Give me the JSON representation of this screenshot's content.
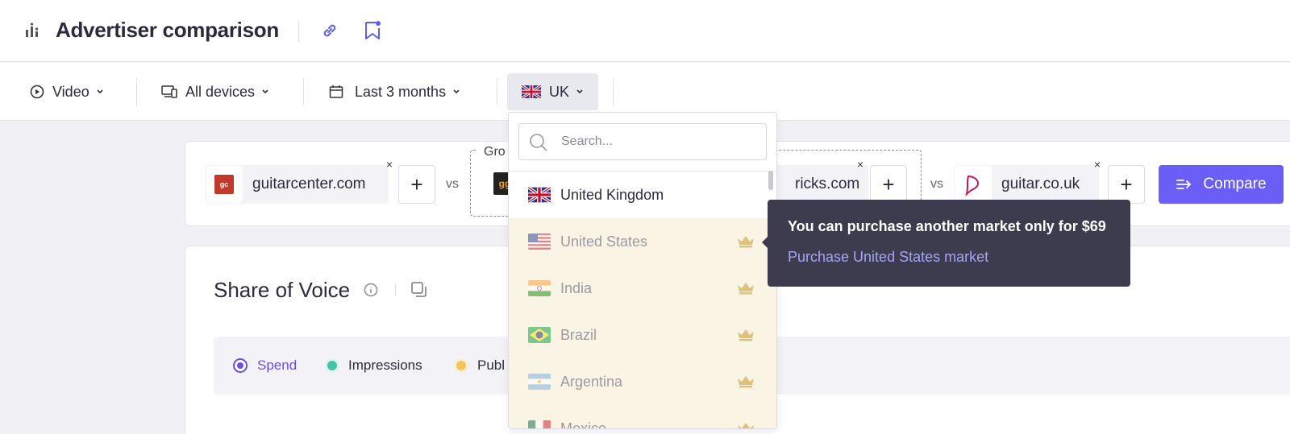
{
  "header": {
    "title": "Advertiser comparison",
    "icons": [
      "bar-chart-icon",
      "link-icon",
      "bookmark-icon"
    ]
  },
  "toolbar": {
    "format": "Video",
    "devices": "All devices",
    "period": "Last 3 months",
    "country": "UK"
  },
  "compare": {
    "chips": [
      {
        "label": "guitarcenter.com",
        "logo": "gc"
      },
      {
        "label": "ricks.com",
        "logo": ""
      },
      {
        "label": "guitar.co.uk",
        "logo": ""
      }
    ],
    "group_label": "Gro",
    "vs": "vs",
    "plus": "+",
    "close": "×",
    "compare_label": "Compare"
  },
  "sov": {
    "title": "Share of Voice",
    "metrics": [
      {
        "label": "Spend",
        "color": "#6b4fe0",
        "selected": true
      },
      {
        "label": "Impressions",
        "color": "#3fc4a4",
        "selected": false
      },
      {
        "label": "Publ",
        "color": "#f1c75b",
        "selected": false
      }
    ]
  },
  "dropdown": {
    "search_placeholder": "Search...",
    "options": [
      {
        "name": "United Kingdom",
        "locked": false
      },
      {
        "name": "United States",
        "locked": true
      },
      {
        "name": "India",
        "locked": true
      },
      {
        "name": "Brazil",
        "locked": true
      },
      {
        "name": "Argentina",
        "locked": true
      },
      {
        "name": "Mexico",
        "locked": true
      }
    ]
  },
  "tooltip": {
    "text": "You can purchase another market only for $69",
    "link": "Purchase United States market"
  },
  "colors": {
    "accent": "#6b5ef7",
    "locked_bg": "#faf4e4",
    "crown": "#e0c17a",
    "tooltip_bg": "#3c3c4e"
  }
}
